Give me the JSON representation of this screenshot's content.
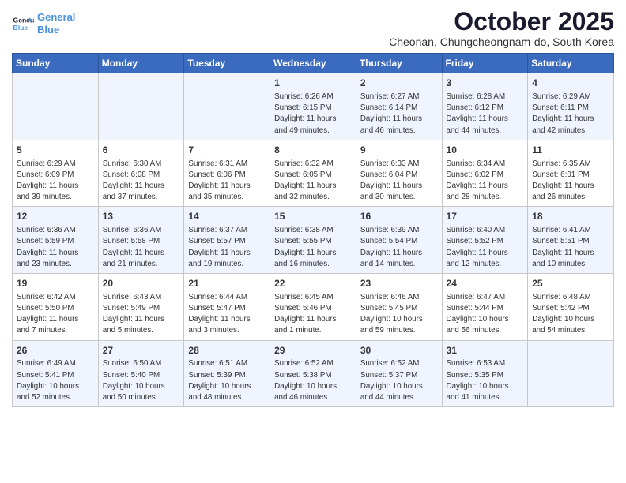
{
  "header": {
    "logo_line1": "General",
    "logo_line2": "Blue",
    "month_title": "October 2025",
    "subtitle": "Cheonan, Chungcheongnam-do, South Korea"
  },
  "weekdays": [
    "Sunday",
    "Monday",
    "Tuesday",
    "Wednesday",
    "Thursday",
    "Friday",
    "Saturday"
  ],
  "weeks": [
    [
      {
        "day": "",
        "info": ""
      },
      {
        "day": "",
        "info": ""
      },
      {
        "day": "",
        "info": ""
      },
      {
        "day": "1",
        "info": "Sunrise: 6:26 AM\nSunset: 6:15 PM\nDaylight: 11 hours\nand 49 minutes."
      },
      {
        "day": "2",
        "info": "Sunrise: 6:27 AM\nSunset: 6:14 PM\nDaylight: 11 hours\nand 46 minutes."
      },
      {
        "day": "3",
        "info": "Sunrise: 6:28 AM\nSunset: 6:12 PM\nDaylight: 11 hours\nand 44 minutes."
      },
      {
        "day": "4",
        "info": "Sunrise: 6:29 AM\nSunset: 6:11 PM\nDaylight: 11 hours\nand 42 minutes."
      }
    ],
    [
      {
        "day": "5",
        "info": "Sunrise: 6:29 AM\nSunset: 6:09 PM\nDaylight: 11 hours\nand 39 minutes."
      },
      {
        "day": "6",
        "info": "Sunrise: 6:30 AM\nSunset: 6:08 PM\nDaylight: 11 hours\nand 37 minutes."
      },
      {
        "day": "7",
        "info": "Sunrise: 6:31 AM\nSunset: 6:06 PM\nDaylight: 11 hours\nand 35 minutes."
      },
      {
        "day": "8",
        "info": "Sunrise: 6:32 AM\nSunset: 6:05 PM\nDaylight: 11 hours\nand 32 minutes."
      },
      {
        "day": "9",
        "info": "Sunrise: 6:33 AM\nSunset: 6:04 PM\nDaylight: 11 hours\nand 30 minutes."
      },
      {
        "day": "10",
        "info": "Sunrise: 6:34 AM\nSunset: 6:02 PM\nDaylight: 11 hours\nand 28 minutes."
      },
      {
        "day": "11",
        "info": "Sunrise: 6:35 AM\nSunset: 6:01 PM\nDaylight: 11 hours\nand 26 minutes."
      }
    ],
    [
      {
        "day": "12",
        "info": "Sunrise: 6:36 AM\nSunset: 5:59 PM\nDaylight: 11 hours\nand 23 minutes."
      },
      {
        "day": "13",
        "info": "Sunrise: 6:36 AM\nSunset: 5:58 PM\nDaylight: 11 hours\nand 21 minutes."
      },
      {
        "day": "14",
        "info": "Sunrise: 6:37 AM\nSunset: 5:57 PM\nDaylight: 11 hours\nand 19 minutes."
      },
      {
        "day": "15",
        "info": "Sunrise: 6:38 AM\nSunset: 5:55 PM\nDaylight: 11 hours\nand 16 minutes."
      },
      {
        "day": "16",
        "info": "Sunrise: 6:39 AM\nSunset: 5:54 PM\nDaylight: 11 hours\nand 14 minutes."
      },
      {
        "day": "17",
        "info": "Sunrise: 6:40 AM\nSunset: 5:52 PM\nDaylight: 11 hours\nand 12 minutes."
      },
      {
        "day": "18",
        "info": "Sunrise: 6:41 AM\nSunset: 5:51 PM\nDaylight: 11 hours\nand 10 minutes."
      }
    ],
    [
      {
        "day": "19",
        "info": "Sunrise: 6:42 AM\nSunset: 5:50 PM\nDaylight: 11 hours\nand 7 minutes."
      },
      {
        "day": "20",
        "info": "Sunrise: 6:43 AM\nSunset: 5:49 PM\nDaylight: 11 hours\nand 5 minutes."
      },
      {
        "day": "21",
        "info": "Sunrise: 6:44 AM\nSunset: 5:47 PM\nDaylight: 11 hours\nand 3 minutes."
      },
      {
        "day": "22",
        "info": "Sunrise: 6:45 AM\nSunset: 5:46 PM\nDaylight: 11 hours\nand 1 minute."
      },
      {
        "day": "23",
        "info": "Sunrise: 6:46 AM\nSunset: 5:45 PM\nDaylight: 10 hours\nand 59 minutes."
      },
      {
        "day": "24",
        "info": "Sunrise: 6:47 AM\nSunset: 5:44 PM\nDaylight: 10 hours\nand 56 minutes."
      },
      {
        "day": "25",
        "info": "Sunrise: 6:48 AM\nSunset: 5:42 PM\nDaylight: 10 hours\nand 54 minutes."
      }
    ],
    [
      {
        "day": "26",
        "info": "Sunrise: 6:49 AM\nSunset: 5:41 PM\nDaylight: 10 hours\nand 52 minutes."
      },
      {
        "day": "27",
        "info": "Sunrise: 6:50 AM\nSunset: 5:40 PM\nDaylight: 10 hours\nand 50 minutes."
      },
      {
        "day": "28",
        "info": "Sunrise: 6:51 AM\nSunset: 5:39 PM\nDaylight: 10 hours\nand 48 minutes."
      },
      {
        "day": "29",
        "info": "Sunrise: 6:52 AM\nSunset: 5:38 PM\nDaylight: 10 hours\nand 46 minutes."
      },
      {
        "day": "30",
        "info": "Sunrise: 6:52 AM\nSunset: 5:37 PM\nDaylight: 10 hours\nand 44 minutes."
      },
      {
        "day": "31",
        "info": "Sunrise: 6:53 AM\nSunset: 5:35 PM\nDaylight: 10 hours\nand 41 minutes."
      },
      {
        "day": "",
        "info": ""
      }
    ]
  ]
}
